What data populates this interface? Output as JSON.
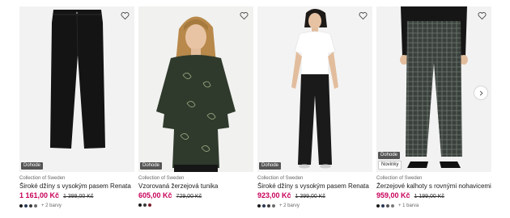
{
  "products": [
    {
      "brand": "Collection of Sweden",
      "title": "Široké džíny s vysokým pasem Renata",
      "price": "1 161,00 Kč",
      "old_price": "1 399,00 Kč",
      "badges": [
        "Dohode"
      ],
      "colors": [
        "#1b1b1b",
        "#2b3a55",
        "#3d3d3d",
        "#6b6b6b"
      ],
      "more_colors": "+ 2 barvy"
    },
    {
      "brand": "Collection of Sweden",
      "title": "Vzorovaná žerzejová tunika",
      "price": "605,00 Kč",
      "old_price": "729,00 Kč",
      "badges": [
        "Dohode"
      ],
      "colors": [
        "#1b1b1b",
        "#3a3a3a",
        "#7a1f2b"
      ],
      "more_colors": ""
    },
    {
      "brand": "Collection of Sweden",
      "title": "Široké džíny s vysokým pasem Renata",
      "price": "923,00 Kč",
      "old_price": "1 399,00 Kč",
      "badges": [
        "Dohode"
      ],
      "colors": [
        "#1b1b1b",
        "#2b3a55",
        "#3d3d3d",
        "#6b6b6b"
      ],
      "more_colors": "+ 2 barvy"
    },
    {
      "brand": "Collection of Sweden",
      "title": "Žerzejové kalhoty s rovnými nohavicemi",
      "price": "959,00 Kč",
      "old_price": "1 199,00 Kč",
      "badges": [
        "Dohode",
        "Novinky"
      ],
      "colors": [
        "#1b1b1b",
        "#2b3a55",
        "#555555",
        "#7a7a7a"
      ],
      "more_colors": "+ 1 barva"
    }
  ],
  "icons": {
    "favorite": "heart-outline-icon",
    "next": "chevron-right-icon"
  },
  "accent_color": "#c8005a"
}
